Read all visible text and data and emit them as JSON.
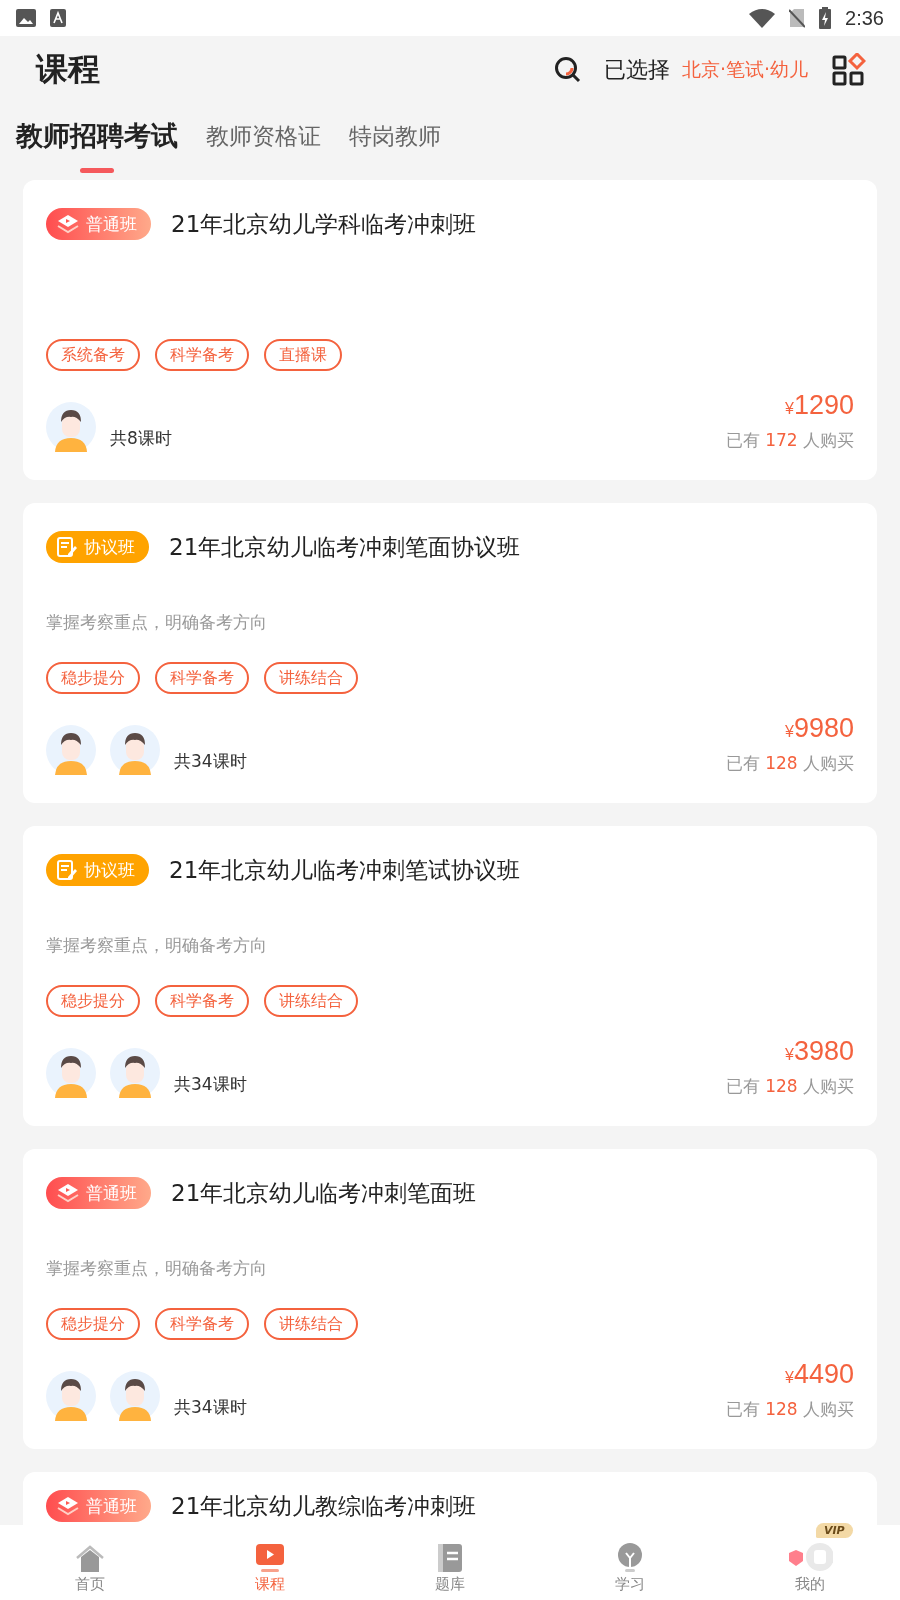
{
  "status_bar": {
    "time": "2:36"
  },
  "header": {
    "title": "课程",
    "selected_label": "已选择",
    "selected_value": "北京·笔试·幼儿"
  },
  "tabs": [
    {
      "label": "教师招聘考试",
      "selected": true
    },
    {
      "label": "教师资格证",
      "selected": false
    },
    {
      "label": "特岗教师",
      "selected": false
    }
  ],
  "courses": [
    {
      "badge": {
        "kind": "regular",
        "label": "普通班"
      },
      "title": "21年北京幼儿学科临考冲刺班",
      "tags": [
        "系统备考",
        "科学备考",
        "直播课"
      ],
      "teachers": [
        {
          "kind": "avatar"
        }
      ],
      "lessons": "共8课时",
      "price_symbol": "¥",
      "price": "1290",
      "buyers_prefix": "已有",
      "buyers_count": "172",
      "buyers_suffix": "人购买"
    },
    {
      "badge": {
        "kind": "agreement",
        "label": "协议班"
      },
      "title": "21年北京幼儿临考冲刺笔面协议班",
      "subtitle": "掌握考察重点，明确备考方向",
      "tags": [
        "稳步提分",
        "科学备考",
        "讲练结合"
      ],
      "teachers": [
        {
          "kind": "avatar"
        },
        {
          "kind": "avatar"
        }
      ],
      "lessons": "共34课时",
      "price_symbol": "¥",
      "price": "9980",
      "buyers_prefix": "已有",
      "buyers_count": "128",
      "buyers_suffix": "人购买"
    },
    {
      "badge": {
        "kind": "agreement",
        "label": "协议班"
      },
      "title": "21年北京幼儿临考冲刺笔试协议班",
      "subtitle": "掌握考察重点，明确备考方向",
      "tags": [
        "稳步提分",
        "科学备考",
        "讲练结合"
      ],
      "teachers": [
        {
          "kind": "avatar"
        },
        {
          "kind": "avatar"
        }
      ],
      "lessons": "共34课时",
      "price_symbol": "¥",
      "price": "3980",
      "buyers_prefix": "已有",
      "buyers_count": "128",
      "buyers_suffix": "人购买"
    },
    {
      "badge": {
        "kind": "regular",
        "label": "普通班"
      },
      "title": "21年北京幼儿临考冲刺笔面班",
      "subtitle": "掌握考察重点，明确备考方向",
      "tags": [
        "稳步提分",
        "科学备考",
        "讲练结合"
      ],
      "teachers": [
        {
          "kind": "avatar"
        },
        {
          "kind": "avatar"
        }
      ],
      "lessons": "共34课时",
      "price_symbol": "¥",
      "price": "4490",
      "buyers_prefix": "已有",
      "buyers_count": "128",
      "buyers_suffix": "人购买"
    },
    {
      "badge": {
        "kind": "regular",
        "label": "普通班"
      },
      "title": "21年北京幼儿教综临考冲刺班"
    }
  ],
  "bottom_nav": [
    {
      "kind": "home",
      "label": "首页",
      "selected": false
    },
    {
      "kind": "course",
      "label": "课程",
      "selected": true
    },
    {
      "kind": "questions",
      "label": "题库",
      "selected": false
    },
    {
      "kind": "study",
      "label": "学习",
      "selected": false
    },
    {
      "kind": "mine",
      "label": "我的",
      "selected": false,
      "badge": "VIP"
    }
  ]
}
